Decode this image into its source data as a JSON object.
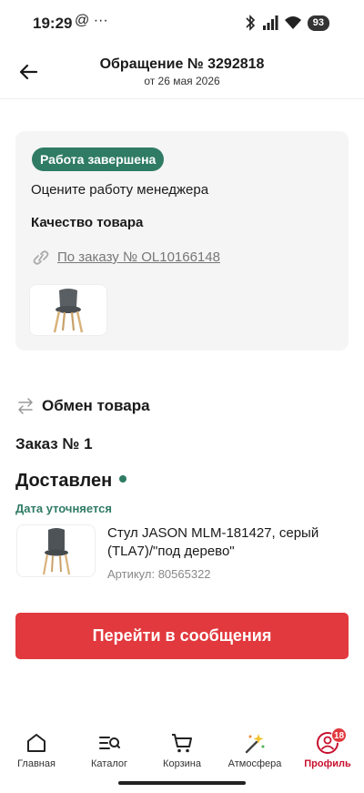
{
  "status_bar": {
    "time": "19:29",
    "left_icons": "@ ···",
    "battery": "93"
  },
  "header": {
    "title": "Обращение № 3292818",
    "subtitle": "от 26 мая 2026"
  },
  "card": {
    "badge": "Работа завершена",
    "rate_text": "Оцените работу менеджера",
    "quality_title": "Качество товара",
    "order_link": "По заказу № OL10166148"
  },
  "exchange": {
    "label": "Обмен товара"
  },
  "order": {
    "number": "Заказ № 1",
    "status": "Доставлен",
    "date_note": "Дата уточняется",
    "product_name": "Стул JASON MLM-181427, серый (TLA7)/\"под дерево\"",
    "product_article": "Артикул: 80565322"
  },
  "cta": {
    "label": "Перейти в сообщения"
  },
  "bottom_nav": {
    "items": [
      {
        "label": "Главная",
        "icon": "home-icon"
      },
      {
        "label": "Каталог",
        "icon": "catalog-icon"
      },
      {
        "label": "Корзина",
        "icon": "cart-icon"
      },
      {
        "label": "Атмосфера",
        "icon": "magic-wand-icon"
      },
      {
        "label": "Профиль",
        "icon": "profile-icon",
        "badge": "18"
      }
    ]
  },
  "colors": {
    "accent_green": "#2f7b64",
    "accent_red": "#e1393d",
    "active_nav": "#c8102e"
  }
}
